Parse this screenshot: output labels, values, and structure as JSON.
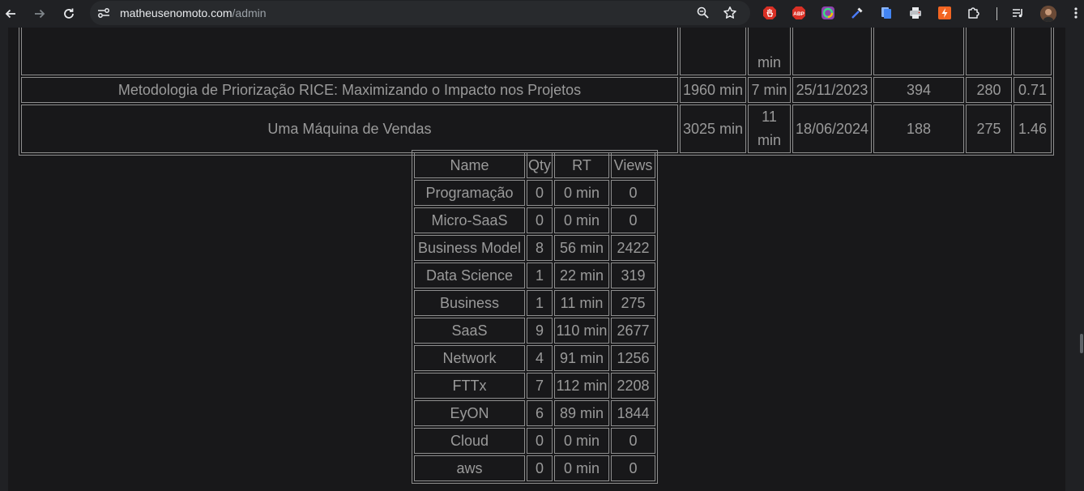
{
  "browser": {
    "url_host": "matheusenomoto.com",
    "url_path": "/admin",
    "extensions": [
      "adblock-hand-icon",
      "abp-icon",
      "color-ring-icon",
      "eyedropper-icon",
      "docs-icon",
      "printer-icon",
      "bolt-icon",
      "puzzle-icon"
    ],
    "extension_badge": "ABP"
  },
  "posts_table": {
    "rows": [
      {
        "title": "",
        "time": "",
        "read": "min",
        "date": "",
        "views": "",
        "c1": "",
        "c2": ""
      },
      {
        "title": "Metodologia de Priorização RICE: Maximizando o Impacto nos Projetos",
        "time": "1960 min",
        "read": "7 min",
        "date": "25/11/2023",
        "views": "394",
        "c1": "280",
        "c2": "0.71"
      },
      {
        "title": "Uma Máquina de Vendas",
        "time": "3025 min",
        "read": "11 min",
        "date": "18/06/2024",
        "views": "188",
        "c1": "275",
        "c2": "1.46"
      }
    ]
  },
  "category_table": {
    "headers": [
      "Name",
      "Qty",
      "RT",
      "Views"
    ],
    "rows": [
      [
        "Programação",
        "0",
        "0 min",
        "0"
      ],
      [
        "Micro-SaaS",
        "0",
        "0 min",
        "0"
      ],
      [
        "Business Model",
        "8",
        "56 min",
        "2422"
      ],
      [
        "Data Science",
        "1",
        "22 min",
        "319"
      ],
      [
        "Business",
        "1",
        "11 min",
        "275"
      ],
      [
        "SaaS",
        "9",
        "110 min",
        "2677"
      ],
      [
        "Network",
        "4",
        "91 min",
        "1256"
      ],
      [
        "FTTx",
        "7",
        "112 min",
        "2208"
      ],
      [
        "EyON",
        "6",
        "89 min",
        "1844"
      ],
      [
        "Cloud",
        "0",
        "0 min",
        "0"
      ],
      [
        "aws",
        "0",
        "0 min",
        "0"
      ]
    ]
  }
}
